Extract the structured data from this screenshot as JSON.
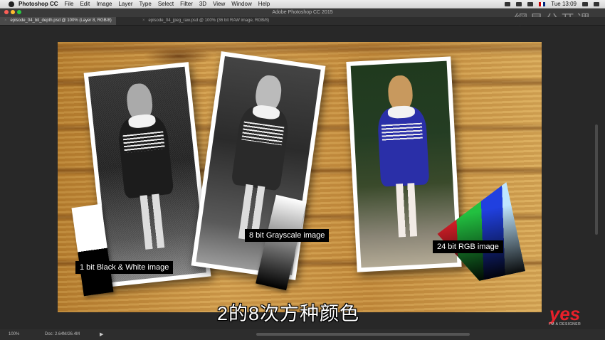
{
  "menubar": {
    "app_name": "Photoshop CC",
    "items": [
      "File",
      "Edit",
      "Image",
      "Layer",
      "Type",
      "Select",
      "Filter",
      "3D",
      "View",
      "Window",
      "Help"
    ],
    "clock": "Tue 13:09"
  },
  "window": {
    "title": "Adobe Photoshop CC 2015"
  },
  "watermark": "網易公开课",
  "tabs": [
    {
      "label": "episode_04_bit_depth.psd @ 100% (Layer 8, RGB/8)",
      "active": true
    },
    {
      "label": "episode_04_jpeg_raw.psd @ 100% (36 bit RAW image, RGB/8)",
      "active": false
    }
  ],
  "canvas": {
    "labels": {
      "bw": "1 bit Black & White image",
      "gray": "8 bit Grayscale image",
      "rgb": "24 bit RGB image"
    }
  },
  "subtitle": "2的8次方种颜色",
  "logo": {
    "big": "yes",
    "small": "I'M A DESIGNER"
  },
  "statusbar": {
    "zoom": "100%",
    "doc": "Doc: 2.64M/26.4M"
  },
  "colors": {
    "accent_red": "#e8202a",
    "ui_bg": "#282828"
  },
  "icons": [
    "apple-logo-icon",
    "dropbox-icon",
    "wifi-icon",
    "battery-icon",
    "flag-uk-icon",
    "search-icon",
    "menu-icon",
    "close-icon",
    "chevron-right-icon"
  ]
}
